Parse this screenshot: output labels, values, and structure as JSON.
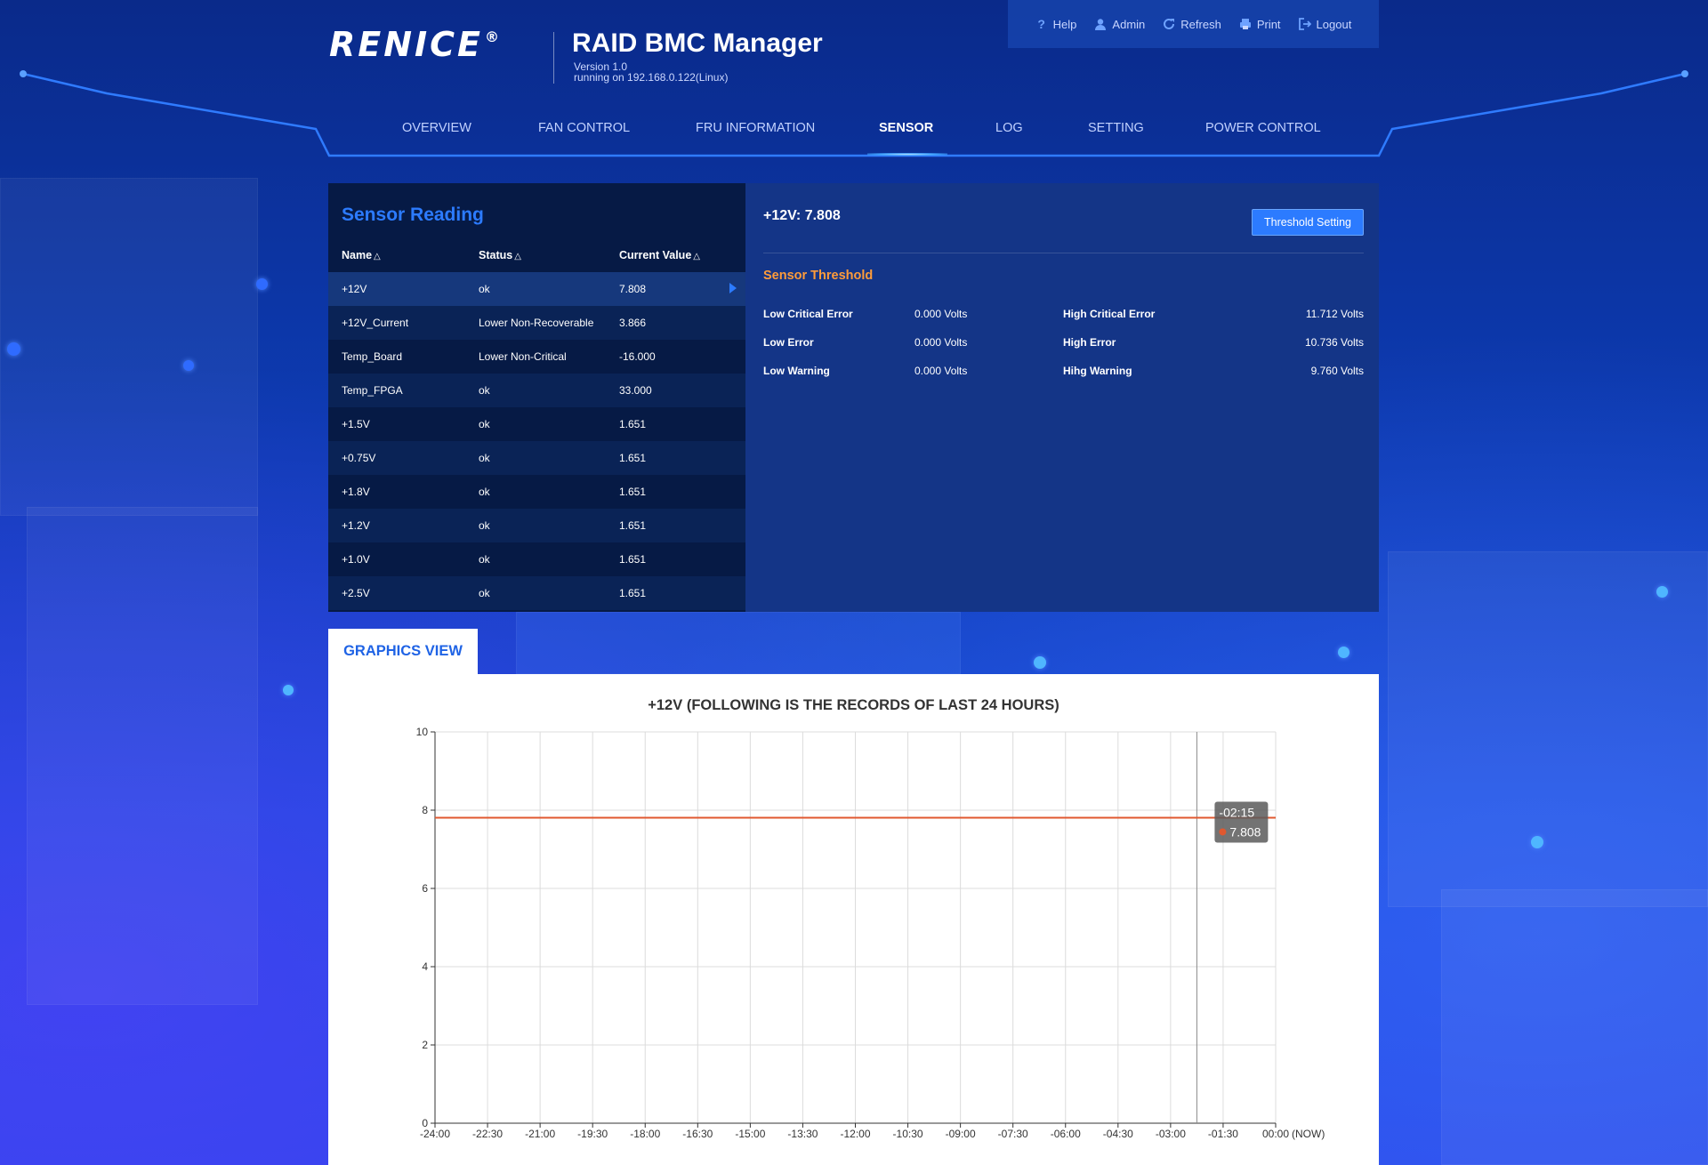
{
  "brand": {
    "logo": "RENICE",
    "registered": "®",
    "title": "RAID BMC Manager",
    "version": "Version 1.0",
    "running": "running on 192.168.0.122(Linux)"
  },
  "toolbar": [
    {
      "label": "Help",
      "icon": "help-icon"
    },
    {
      "label": "Admin",
      "icon": "user-icon"
    },
    {
      "label": "Refresh",
      "icon": "refresh-icon"
    },
    {
      "label": "Print",
      "icon": "print-icon"
    },
    {
      "label": "Logout",
      "icon": "logout-icon"
    }
  ],
  "nav": [
    {
      "label": "OVERVIEW"
    },
    {
      "label": "FAN CONTROL"
    },
    {
      "label": "FRU INFORMATION"
    },
    {
      "label": "SENSOR",
      "active": true
    },
    {
      "label": "LOG"
    },
    {
      "label": "SETTING"
    },
    {
      "label": "POWER CONTROL"
    }
  ],
  "sensor_reading": {
    "title": "Sensor Reading",
    "columns": {
      "name": "Name",
      "status": "Status",
      "value": "Current Value",
      "sort_glyph": "△"
    },
    "rows": [
      {
        "name": "+12V",
        "status": "ok",
        "value": "7.808",
        "selected": true
      },
      {
        "name": "+12V_Current",
        "status": "Lower Non-Recoverable",
        "value": "3.866"
      },
      {
        "name": "Temp_Board",
        "status": "Lower Non-Critical",
        "value": "-16.000"
      },
      {
        "name": "Temp_FPGA",
        "status": "ok",
        "value": "33.000"
      },
      {
        "name": "+1.5V",
        "status": "ok",
        "value": "1.651"
      },
      {
        "name": "+0.75V",
        "status": "ok",
        "value": "1.651"
      },
      {
        "name": "+1.8V",
        "status": "ok",
        "value": "1.651"
      },
      {
        "name": "+1.2V",
        "status": "ok",
        "value": "1.651"
      },
      {
        "name": "+1.0V",
        "status": "ok",
        "value": "1.651"
      },
      {
        "name": "+2.5V",
        "status": "ok",
        "value": "1.651"
      }
    ]
  },
  "sensor_detail": {
    "heading": "+12V: 7.808",
    "threshold_button": "Threshold Setting",
    "threshold_title": "Sensor Threshold",
    "thresholds": [
      {
        "label": "Low Critical Error",
        "value": "0.000 Volts"
      },
      {
        "label": "High Critical Error",
        "value": "11.712 Volts"
      },
      {
        "label": "Low Error",
        "value": "0.000 Volts"
      },
      {
        "label": "High Error",
        "value": "10.736 Volts"
      },
      {
        "label": "Low Warning",
        "value": "0.000 Volts"
      },
      {
        "label": "Hihg Warning",
        "value": "9.760 Volts"
      }
    ]
  },
  "graphics": {
    "tab_label": "GRAPHICS VIEW"
  },
  "colors": {
    "accent": "#2c7bff",
    "threshold_title": "#ff9c3a",
    "series": "#e0582f"
  },
  "chart_data": {
    "type": "line",
    "title": "+12V (FOLLOWING IS THE RECORDS OF LAST 24 HOURS)",
    "x_labels": [
      "-24:00",
      "-22:30",
      "-21:00",
      "-19:30",
      "-18:00",
      "-16:30",
      "-15:00",
      "-13:30",
      "-12:00",
      "-10:30",
      "-09:00",
      "-07:30",
      "-06:00",
      "-04:30",
      "-03:00",
      "-01:30",
      "00:00",
      "(NOW)"
    ],
    "x_hours": [
      -24,
      -22.5,
      -21,
      -19.5,
      -18,
      -16.5,
      -15,
      -13.5,
      -12,
      -10.5,
      -9,
      -7.5,
      -6,
      -4.5,
      -3,
      -1.5,
      0
    ],
    "xlim": [
      -24,
      0
    ],
    "ylim": [
      0,
      10
    ],
    "yticks": [
      0,
      2,
      4,
      6,
      8,
      10
    ],
    "series": [
      {
        "x": [
          -24,
          0
        ],
        "y": [
          7.808,
          7.808
        ]
      }
    ],
    "tooltip": {
      "time": "-02:15",
      "value": "7.808",
      "x_hours": -2.25
    },
    "grid": true
  }
}
